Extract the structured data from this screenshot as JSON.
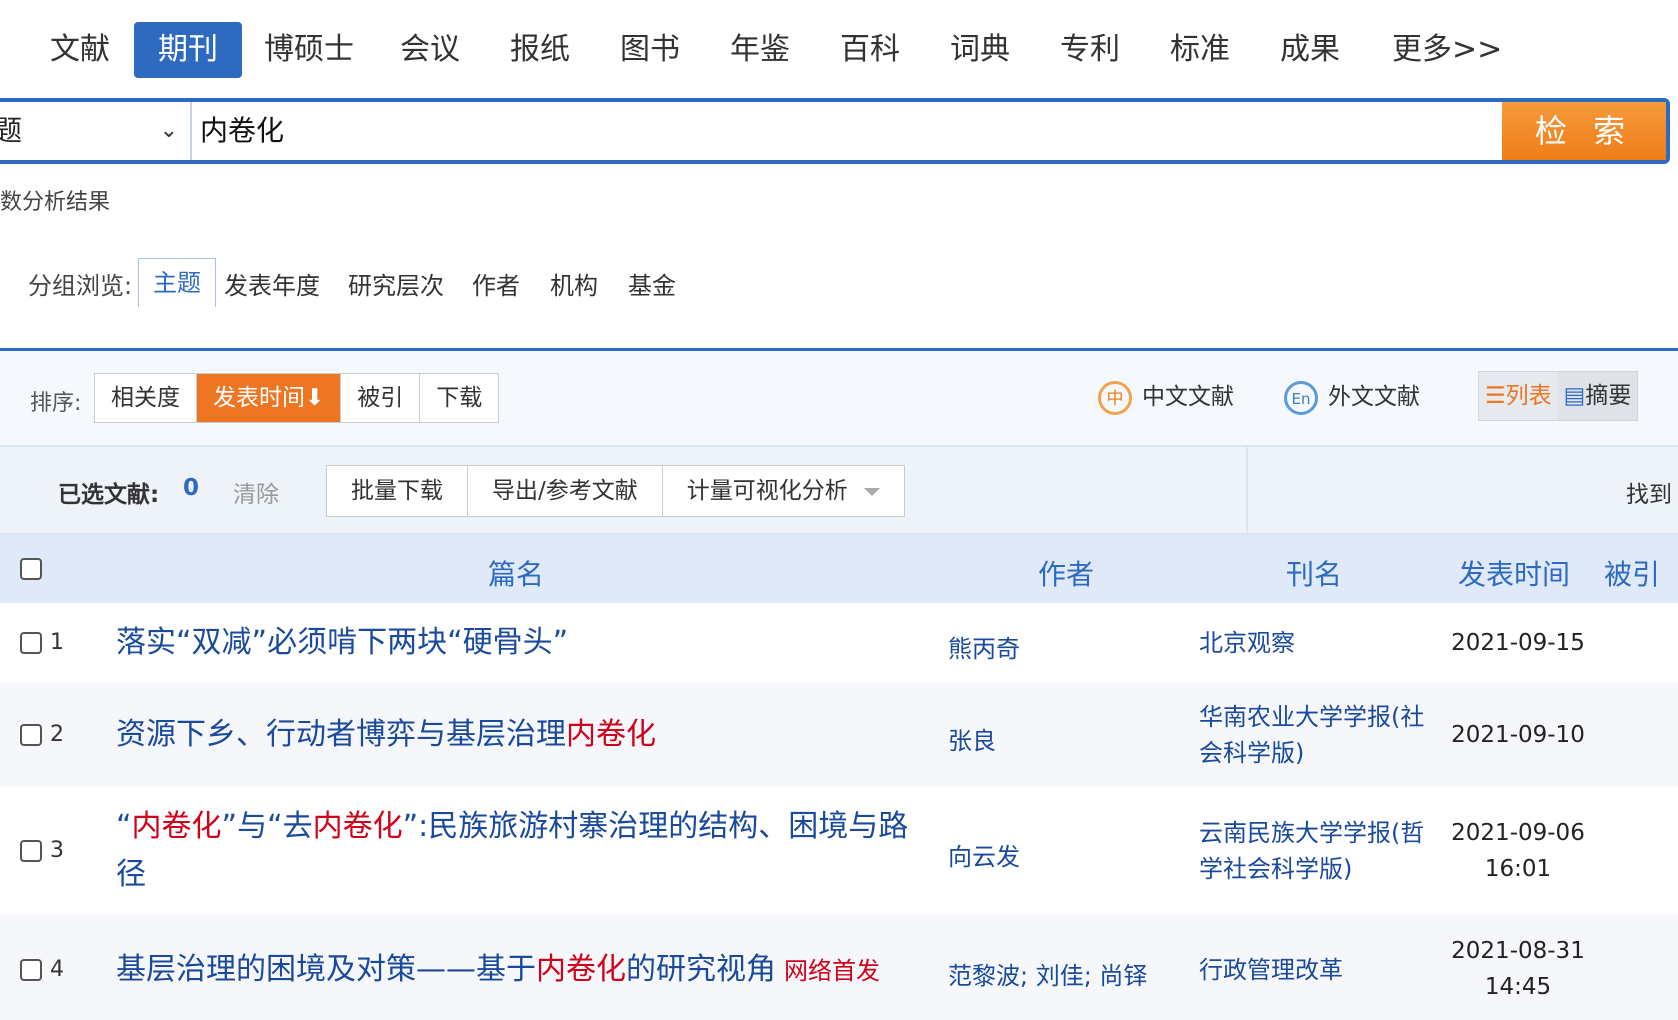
{
  "tabs": [
    "文献",
    "期刊",
    "博硕士",
    "会议",
    "报纸",
    "图书",
    "年鉴",
    "百科",
    "词典",
    "专利",
    "标准",
    "成果",
    "更多>>"
  ],
  "search": {
    "field_value": "题",
    "query": "内卷化",
    "button": "检 索"
  },
  "analysis_link": "数分析结果",
  "group": {
    "label": "分组浏览:",
    "items": [
      "主题",
      "发表年度",
      "研究层次",
      "作者",
      "机构",
      "基金"
    ]
  },
  "sort": {
    "label": "排序:",
    "options": [
      "相关度",
      "发表时间",
      "被引",
      "下载"
    ],
    "active_arrow": "⬇"
  },
  "lang": {
    "cn_icon_text": "中",
    "cn_label": "中文文献",
    "en_icon_text": "En",
    "en_label": "外文文献"
  },
  "view": {
    "list_label": "列表",
    "abstract_label": "摘要"
  },
  "selection": {
    "label": "已选文献:",
    "count": "0",
    "clear": "清除",
    "ops": [
      "批量下载",
      "导出/参考文献",
      "计量可视化分析"
    ],
    "found": "找到"
  },
  "columns": {
    "title": "篇名",
    "author": "作者",
    "journal": "刊名",
    "date": "发表时间",
    "cited": "被引"
  },
  "rows": [
    {
      "num": "1",
      "title_parts": [
        "落实“双减”必须啃下两块“硬骨头”"
      ],
      "author": "熊丙奇",
      "journal": "北京观察",
      "date_line1": "2021-09-15",
      "date_line2": ""
    },
    {
      "num": "2",
      "title_parts": [
        "资源下乡、行动者博弈与基层治理",
        "内卷化"
      ],
      "author": "张良",
      "journal": "华南农业大学学报(社会科学版)",
      "date_line1": "2021-09-10",
      "date_line2": ""
    },
    {
      "num": "3",
      "title_parts": [
        "“",
        "内卷化",
        "”与“去",
        "内卷化",
        "”:民族旅游村寨治理的结构、困境与路径"
      ],
      "author": "向云发",
      "journal": "云南民族大学学报(哲学社会科学版)",
      "date_line1": "2021-09-06",
      "date_line2": "16:01"
    },
    {
      "num": "4",
      "title_parts": [
        "基层治理的困境及对策——基于",
        "内卷化",
        "的研究视角"
      ],
      "tag": "网络首发",
      "author": "范黎波; 刘佳; 尚铎",
      "journal": "行政管理改革",
      "date_line1": "2021-08-31",
      "date_line2": "14:45"
    }
  ],
  "colors": {
    "accent_blue": "#2f6ac1",
    "accent_orange": "#ee7522",
    "highlight_red": "#d0021b"
  }
}
